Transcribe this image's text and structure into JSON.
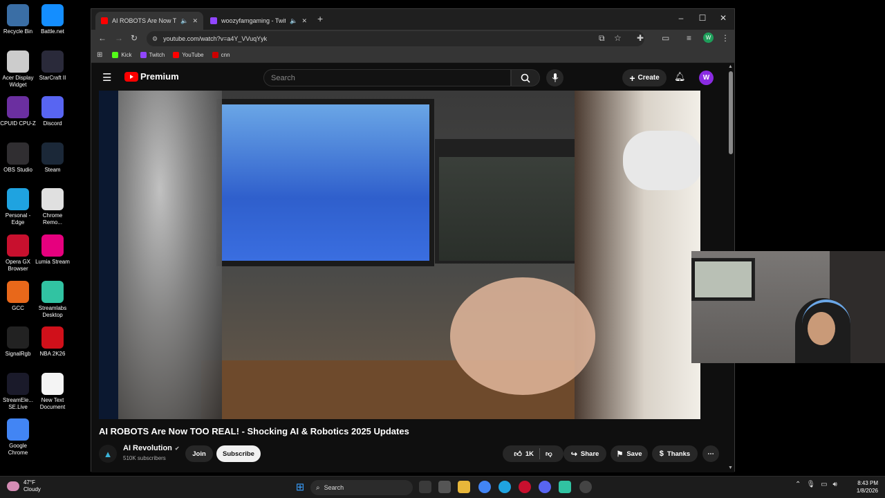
{
  "desktop": {
    "icons": [
      {
        "label": "Recycle Bin",
        "icon": "recycle-bin-icon",
        "color": "#3a6ea5"
      },
      {
        "label": "Battle.net",
        "icon": "battlenet-icon",
        "color": "#148eff"
      },
      {
        "label": "Acer Display Widget",
        "icon": "acer-widget-icon",
        "color": "#cccccc"
      },
      {
        "label": "StarCraft II",
        "icon": "starcraft-icon",
        "color": "#2a2a3a"
      },
      {
        "label": "CPUID CPU-Z",
        "icon": "cpuz-icon",
        "color": "#6b2fa0"
      },
      {
        "label": "Discord",
        "icon": "discord-icon",
        "color": "#5865f2"
      },
      {
        "label": "OBS Studio",
        "icon": "obs-icon",
        "color": "#302e31"
      },
      {
        "label": "Steam",
        "icon": "steam-icon",
        "color": "#1b2838"
      },
      {
        "label": "Personal - Edge",
        "icon": "edge-icon",
        "color": "#1fa3e0"
      },
      {
        "label": "Chrome Remo...",
        "icon": "chrome-remote-icon",
        "color": "#e0e0e0"
      },
      {
        "label": "Opera GX Browser",
        "icon": "opera-gx-icon",
        "color": "#c8102e"
      },
      {
        "label": "Lumia Stream",
        "icon": "lumia-icon",
        "color": "#e6007e"
      },
      {
        "label": "GCC",
        "icon": "gcc-icon",
        "color": "#e8681a"
      },
      {
        "label": "Streamlabs Desktop",
        "icon": "streamlabs-icon",
        "color": "#31c3a2"
      },
      {
        "label": "SignalRgb",
        "icon": "signalrgb-icon",
        "color": "#222222"
      },
      {
        "label": "NBA 2K26",
        "icon": "nba2k-icon",
        "color": "#d0101a"
      },
      {
        "label": "StreamEle... SE.Live",
        "icon": "streamelements-icon",
        "color": "#1a1a2a"
      },
      {
        "label": "New Text Document",
        "icon": "text-document-icon",
        "color": "#f4f4f4"
      },
      {
        "label": "Google Chrome",
        "icon": "chrome-icon",
        "color": "#4285f4"
      }
    ]
  },
  "browser": {
    "tabs": [
      {
        "title": "AI ROBOTS Are Now TOO REAL! - Shocking AI & Robotics 2025 Updates",
        "favicon_color": "#ff0000",
        "active": true
      },
      {
        "title": "woozyfamgaming - Twitch",
        "favicon_color": "#9146ff",
        "active": false
      }
    ],
    "url": "youtube.com/watch?v=a4Y_VVuqYyk",
    "bookmarks": [
      {
        "label": "Kick",
        "color": "#53fc18"
      },
      {
        "label": "Twitch",
        "color": "#9146ff"
      },
      {
        "label": "YouTube",
        "color": "#ff0000"
      },
      {
        "label": "cnn",
        "color": "#cc0000"
      }
    ],
    "profile_initial": "W"
  },
  "youtube": {
    "logo_text": "Premium",
    "search_placeholder": "Search",
    "create_label": "Create",
    "avatar_initial": "W",
    "video_title": "AI ROBOTS Are Now TOO REAL! - Shocking AI & Robotics 2025 Updates",
    "channel_name": "AI Revolution",
    "subscribers": "510K subscribers",
    "join_label": "Join",
    "subscribe_label": "Subscribe",
    "like_count": "1K",
    "share_label": "Share",
    "save_label": "Save",
    "thanks_label": "Thanks"
  },
  "taskbar": {
    "weather_temp": "47°F",
    "weather_desc": "Cloudy",
    "search_label": "Search",
    "time": "8:43 PM",
    "date": "1/8/2026"
  }
}
